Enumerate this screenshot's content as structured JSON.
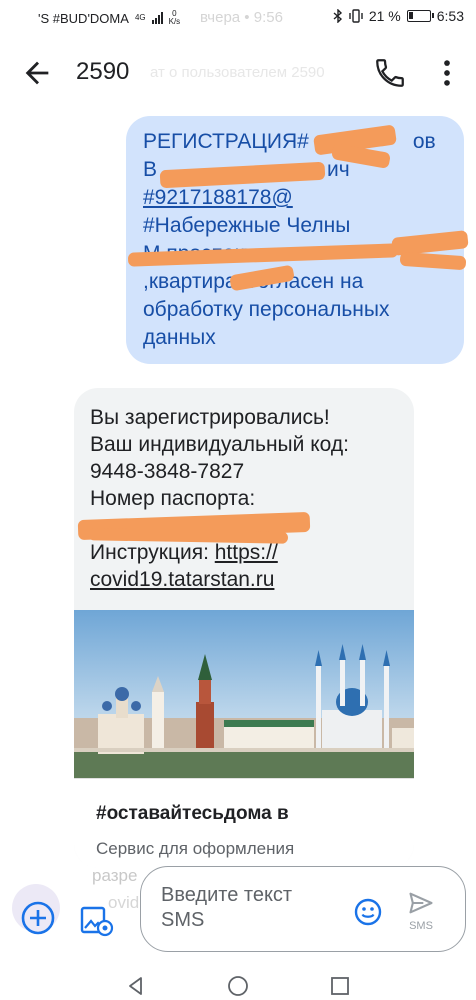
{
  "status_bar": {
    "carrier": "'S #BUD'DOMA",
    "network": "4G",
    "speed_value": "0",
    "speed_unit": "K/s",
    "faded_time": "вчера • 9:56",
    "battery": "21 %",
    "time": "6:53"
  },
  "app_bar": {
    "title": "2590",
    "faded_subtitle": "ат о пользователем 2590",
    "back_icon": "arrow-back-icon",
    "call_icon": "phone-icon",
    "more_icon": "more-vert-icon"
  },
  "outgoing_message": {
    "lines": [
      "РЕГИСТРАЦИЯ#",
      "В",
      "#9217188178@",
      "#Набережные Челны",
      "М                          проспект",
      ",квартира     Согласен на",
      "обработку персональных",
      "данных"
    ],
    "line1_tail": "ов",
    "line2_tail": "ич",
    "line5_head": "М",
    "phone_link": "#9217188178@"
  },
  "incoming_message": {
    "lines": [
      "Вы зарегистрировались!",
      "Ваш индивидуальный код:",
      "9448-3848-7827",
      "Номер паспорта:"
    ],
    "instruction_label": "Инструкция: ",
    "link_part1": "https://",
    "link_part2": "covid19.tatarstan.ru",
    "card_title": "#оставайтесьдома в",
    "card_desc": "Сервис для оформления"
  },
  "compose": {
    "placeholder_line1": "Введите текст",
    "placeholder_line2": "SMS",
    "send_label": "SMS",
    "ghost_text_1": "разре",
    "ghost_text_2": "ovid"
  },
  "colors": {
    "outgoing_bubble": "#d2e3fc",
    "outgoing_text": "#174ea6",
    "incoming_bubble": "#f1f3f4",
    "redaction": "#f49b5a",
    "accent": "#1a73e8"
  }
}
